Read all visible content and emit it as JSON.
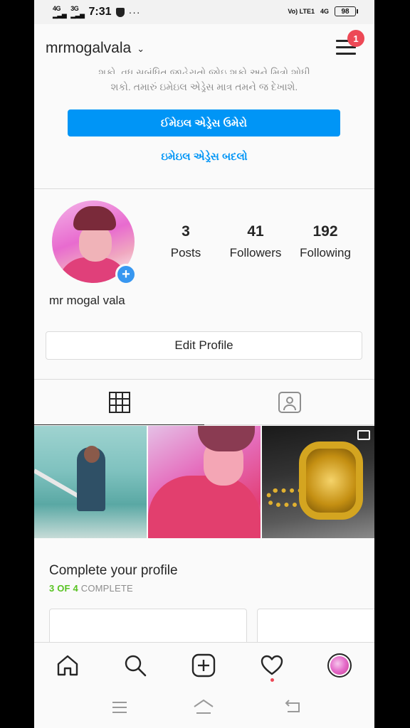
{
  "status_bar": {
    "net_left": "4G",
    "net_left2": "3G",
    "time": "7:31",
    "dots": "···",
    "volte": "Vo) LTE1",
    "net_right": "4G",
    "battery": "98"
  },
  "header": {
    "username": "mrmogalvala",
    "notification_count": "1"
  },
  "email_banner": {
    "text_line1": "શકો, વધુ સબંધિત જાહેરાતો જોઇ શકો અને મિત્રો શોધી",
    "text_line2": "શકો. તમારું ઇમેઇલ એડ્રેસ માત્ર તમને જ દેખાશે.",
    "confirm_button": "ઈમેઇલ એડ્રેસ ઉમેરો",
    "change_link": "ઇમેઇલ એડ્રેસ બદલો"
  },
  "profile": {
    "display_name": "mr mogal vala",
    "add_story_symbol": "+",
    "stats": {
      "posts_count": "3",
      "posts_label": "Posts",
      "followers_count": "41",
      "followers_label": "Followers",
      "following_count": "192",
      "following_label": "Following"
    },
    "edit_profile_button": "Edit Profile"
  },
  "tabs": [
    {
      "name": "grid",
      "icon": "grid-icon",
      "active": true
    },
    {
      "name": "tagged",
      "icon": "tagged-person-icon",
      "active": false
    }
  ],
  "complete_profile": {
    "title": "Complete your profile",
    "progress_done": "3 OF 4",
    "progress_suffix": " COMPLETE"
  },
  "bottom_nav": [
    {
      "name": "home",
      "icon": "home-icon"
    },
    {
      "name": "search",
      "icon": "search-icon"
    },
    {
      "name": "new-post",
      "icon": "plus-square-icon"
    },
    {
      "name": "activity",
      "icon": "heart-icon"
    },
    {
      "name": "profile",
      "icon": "avatar"
    }
  ],
  "colors": {
    "accent": "#0095f6",
    "badge": "#ed4956",
    "progress_green": "#58c322"
  }
}
